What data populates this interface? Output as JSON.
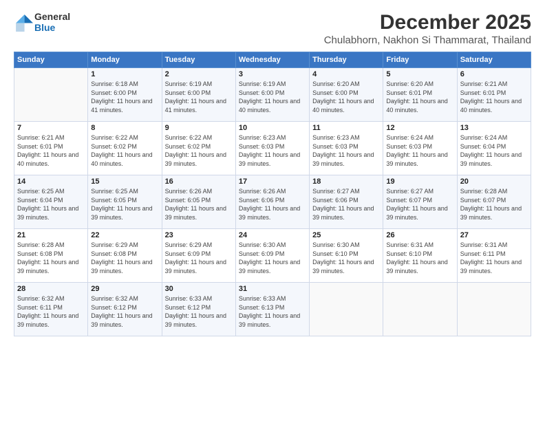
{
  "logo": {
    "line1": "General",
    "line2": "Blue"
  },
  "title": {
    "month_year": "December 2025",
    "location": "Chulabhorn, Nakhon Si Thammarat, Thailand"
  },
  "weekdays": [
    "Sunday",
    "Monday",
    "Tuesday",
    "Wednesday",
    "Thursday",
    "Friday",
    "Saturday"
  ],
  "weeks": [
    [
      {
        "day": "",
        "sunrise": "",
        "sunset": "",
        "daylight": ""
      },
      {
        "day": "1",
        "sunrise": "Sunrise: 6:18 AM",
        "sunset": "Sunset: 6:00 PM",
        "daylight": "Daylight: 11 hours and 41 minutes."
      },
      {
        "day": "2",
        "sunrise": "Sunrise: 6:19 AM",
        "sunset": "Sunset: 6:00 PM",
        "daylight": "Daylight: 11 hours and 41 minutes."
      },
      {
        "day": "3",
        "sunrise": "Sunrise: 6:19 AM",
        "sunset": "Sunset: 6:00 PM",
        "daylight": "Daylight: 11 hours and 40 minutes."
      },
      {
        "day": "4",
        "sunrise": "Sunrise: 6:20 AM",
        "sunset": "Sunset: 6:00 PM",
        "daylight": "Daylight: 11 hours and 40 minutes."
      },
      {
        "day": "5",
        "sunrise": "Sunrise: 6:20 AM",
        "sunset": "Sunset: 6:01 PM",
        "daylight": "Daylight: 11 hours and 40 minutes."
      },
      {
        "day": "6",
        "sunrise": "Sunrise: 6:21 AM",
        "sunset": "Sunset: 6:01 PM",
        "daylight": "Daylight: 11 hours and 40 minutes."
      }
    ],
    [
      {
        "day": "7",
        "sunrise": "Sunrise: 6:21 AM",
        "sunset": "Sunset: 6:01 PM",
        "daylight": "Daylight: 11 hours and 40 minutes."
      },
      {
        "day": "8",
        "sunrise": "Sunrise: 6:22 AM",
        "sunset": "Sunset: 6:02 PM",
        "daylight": "Daylight: 11 hours and 40 minutes."
      },
      {
        "day": "9",
        "sunrise": "Sunrise: 6:22 AM",
        "sunset": "Sunset: 6:02 PM",
        "daylight": "Daylight: 11 hours and 39 minutes."
      },
      {
        "day": "10",
        "sunrise": "Sunrise: 6:23 AM",
        "sunset": "Sunset: 6:03 PM",
        "daylight": "Daylight: 11 hours and 39 minutes."
      },
      {
        "day": "11",
        "sunrise": "Sunrise: 6:23 AM",
        "sunset": "Sunset: 6:03 PM",
        "daylight": "Daylight: 11 hours and 39 minutes."
      },
      {
        "day": "12",
        "sunrise": "Sunrise: 6:24 AM",
        "sunset": "Sunset: 6:03 PM",
        "daylight": "Daylight: 11 hours and 39 minutes."
      },
      {
        "day": "13",
        "sunrise": "Sunrise: 6:24 AM",
        "sunset": "Sunset: 6:04 PM",
        "daylight": "Daylight: 11 hours and 39 minutes."
      }
    ],
    [
      {
        "day": "14",
        "sunrise": "Sunrise: 6:25 AM",
        "sunset": "Sunset: 6:04 PM",
        "daylight": "Daylight: 11 hours and 39 minutes."
      },
      {
        "day": "15",
        "sunrise": "Sunrise: 6:25 AM",
        "sunset": "Sunset: 6:05 PM",
        "daylight": "Daylight: 11 hours and 39 minutes."
      },
      {
        "day": "16",
        "sunrise": "Sunrise: 6:26 AM",
        "sunset": "Sunset: 6:05 PM",
        "daylight": "Daylight: 11 hours and 39 minutes."
      },
      {
        "day": "17",
        "sunrise": "Sunrise: 6:26 AM",
        "sunset": "Sunset: 6:06 PM",
        "daylight": "Daylight: 11 hours and 39 minutes."
      },
      {
        "day": "18",
        "sunrise": "Sunrise: 6:27 AM",
        "sunset": "Sunset: 6:06 PM",
        "daylight": "Daylight: 11 hours and 39 minutes."
      },
      {
        "day": "19",
        "sunrise": "Sunrise: 6:27 AM",
        "sunset": "Sunset: 6:07 PM",
        "daylight": "Daylight: 11 hours and 39 minutes."
      },
      {
        "day": "20",
        "sunrise": "Sunrise: 6:28 AM",
        "sunset": "Sunset: 6:07 PM",
        "daylight": "Daylight: 11 hours and 39 minutes."
      }
    ],
    [
      {
        "day": "21",
        "sunrise": "Sunrise: 6:28 AM",
        "sunset": "Sunset: 6:08 PM",
        "daylight": "Daylight: 11 hours and 39 minutes."
      },
      {
        "day": "22",
        "sunrise": "Sunrise: 6:29 AM",
        "sunset": "Sunset: 6:08 PM",
        "daylight": "Daylight: 11 hours and 39 minutes."
      },
      {
        "day": "23",
        "sunrise": "Sunrise: 6:29 AM",
        "sunset": "Sunset: 6:09 PM",
        "daylight": "Daylight: 11 hours and 39 minutes."
      },
      {
        "day": "24",
        "sunrise": "Sunrise: 6:30 AM",
        "sunset": "Sunset: 6:09 PM",
        "daylight": "Daylight: 11 hours and 39 minutes."
      },
      {
        "day": "25",
        "sunrise": "Sunrise: 6:30 AM",
        "sunset": "Sunset: 6:10 PM",
        "daylight": "Daylight: 11 hours and 39 minutes."
      },
      {
        "day": "26",
        "sunrise": "Sunrise: 6:31 AM",
        "sunset": "Sunset: 6:10 PM",
        "daylight": "Daylight: 11 hours and 39 minutes."
      },
      {
        "day": "27",
        "sunrise": "Sunrise: 6:31 AM",
        "sunset": "Sunset: 6:11 PM",
        "daylight": "Daylight: 11 hours and 39 minutes."
      }
    ],
    [
      {
        "day": "28",
        "sunrise": "Sunrise: 6:32 AM",
        "sunset": "Sunset: 6:11 PM",
        "daylight": "Daylight: 11 hours and 39 minutes."
      },
      {
        "day": "29",
        "sunrise": "Sunrise: 6:32 AM",
        "sunset": "Sunset: 6:12 PM",
        "daylight": "Daylight: 11 hours and 39 minutes."
      },
      {
        "day": "30",
        "sunrise": "Sunrise: 6:33 AM",
        "sunset": "Sunset: 6:12 PM",
        "daylight": "Daylight: 11 hours and 39 minutes."
      },
      {
        "day": "31",
        "sunrise": "Sunrise: 6:33 AM",
        "sunset": "Sunset: 6:13 PM",
        "daylight": "Daylight: 11 hours and 39 minutes."
      },
      {
        "day": "",
        "sunrise": "",
        "sunset": "",
        "daylight": ""
      },
      {
        "day": "",
        "sunrise": "",
        "sunset": "",
        "daylight": ""
      },
      {
        "day": "",
        "sunrise": "",
        "sunset": "",
        "daylight": ""
      }
    ]
  ]
}
